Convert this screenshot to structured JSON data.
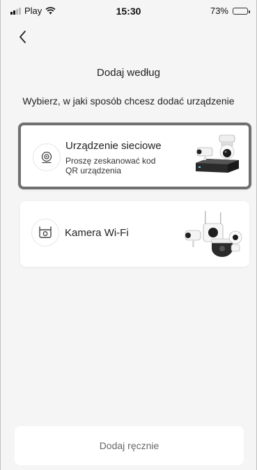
{
  "status_bar": {
    "carrier": "Play",
    "time": "15:30",
    "battery": "73%"
  },
  "header": {
    "title": "Dodaj według",
    "subtitle": "Wybierz, w jaki sposób chcesz dodać urządzenie"
  },
  "options": [
    {
      "title": "Urządzenie sieciowe",
      "description": "Proszę zeskanować kod QR urządzenia",
      "selected": true,
      "icon": "network-device-icon"
    },
    {
      "title": "Kamera Wi-Fi",
      "selected": false,
      "icon": "wifi-camera-icon"
    }
  ],
  "footer": {
    "manual_add_label": "Dodaj ręcznie"
  },
  "colors": {
    "background": "#f5f5f5",
    "card": "#ffffff",
    "selected_border": "#707070"
  }
}
